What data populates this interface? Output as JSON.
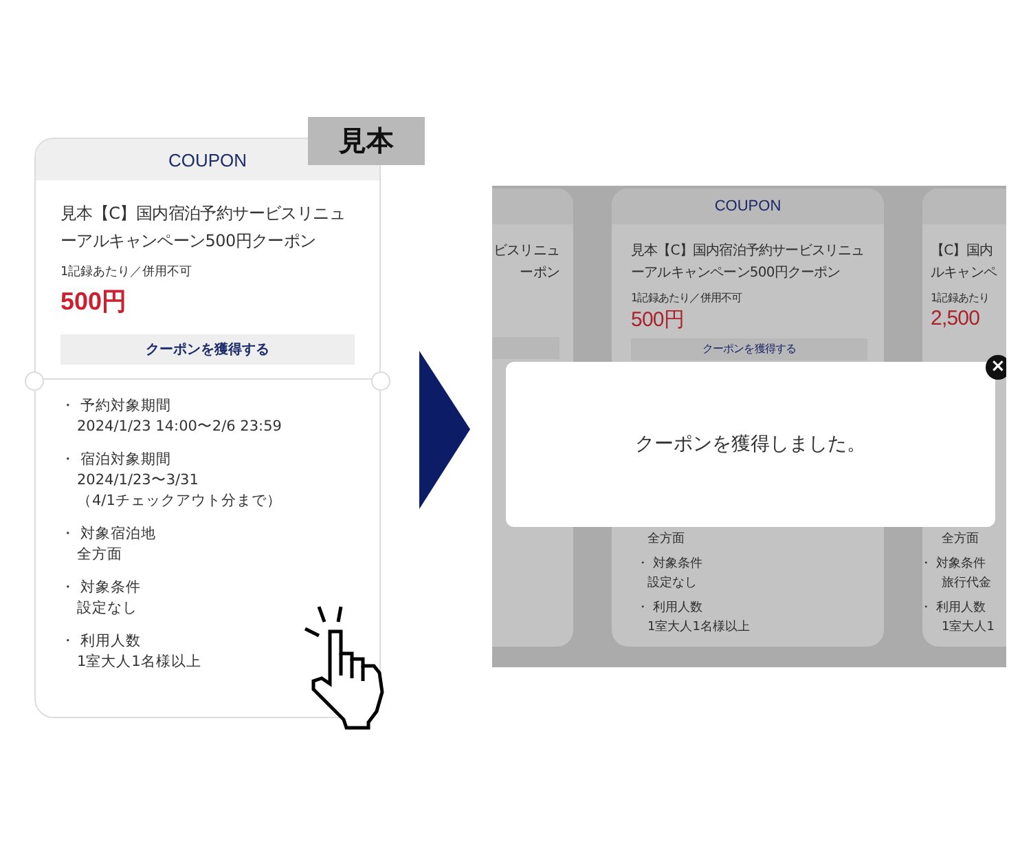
{
  "sample_label": "見本",
  "coupon": {
    "header": "COUPON",
    "title": "見本【C】国内宿泊予約サービスリニューアルキャンペーン500円クーポン",
    "note": "1記録あたり／併用不可",
    "price": "500円",
    "button": "クーポンを獲得する",
    "conditions": [
      {
        "label": "・ 予約対象期間",
        "lines": [
          "2024/1/23 14:00〜2/6 23:59"
        ]
      },
      {
        "label": "・ 宿泊対象期間",
        "lines": [
          "2024/1/23〜3/31",
          "（4/1チェックアウト分まで）"
        ]
      },
      {
        "label": "・ 対象宿泊地",
        "lines": [
          "全方面"
        ]
      },
      {
        "label": "・ 対象条件",
        "lines": [
          "設定なし"
        ]
      },
      {
        "label": "・ 利用人数",
        "lines": [
          "1室大人1名様以上"
        ]
      }
    ]
  },
  "screen": {
    "cards": [
      {
        "kind": "partial_left",
        "title_lines": [
          "ビスリニュ",
          "ーポン"
        ]
      },
      {
        "kind": "full",
        "header": "COUPON",
        "title": "見本【C】国内宿泊予約サービスリニューアルキャンペーン500円クーポン",
        "note": "1記録あたり／併用不可",
        "price": "500円",
        "button": "クーポンを獲得する",
        "lower": [
          "全方面",
          "・ 対象条件",
          "設定なし",
          "・ 利用人数",
          "1室大人1名様以上"
        ]
      },
      {
        "kind": "partial_right",
        "title_lines": [
          "【C】国内",
          "ルキャンペ"
        ],
        "note": "1記録あたり",
        "price": "2,500",
        "lower": [
          "全方面",
          "・ 対象条件",
          "旅行代金",
          "・ 利用人数",
          "1室大人1"
        ]
      }
    ],
    "modal": {
      "message": "クーポンを獲得しました。",
      "close": "×"
    }
  }
}
